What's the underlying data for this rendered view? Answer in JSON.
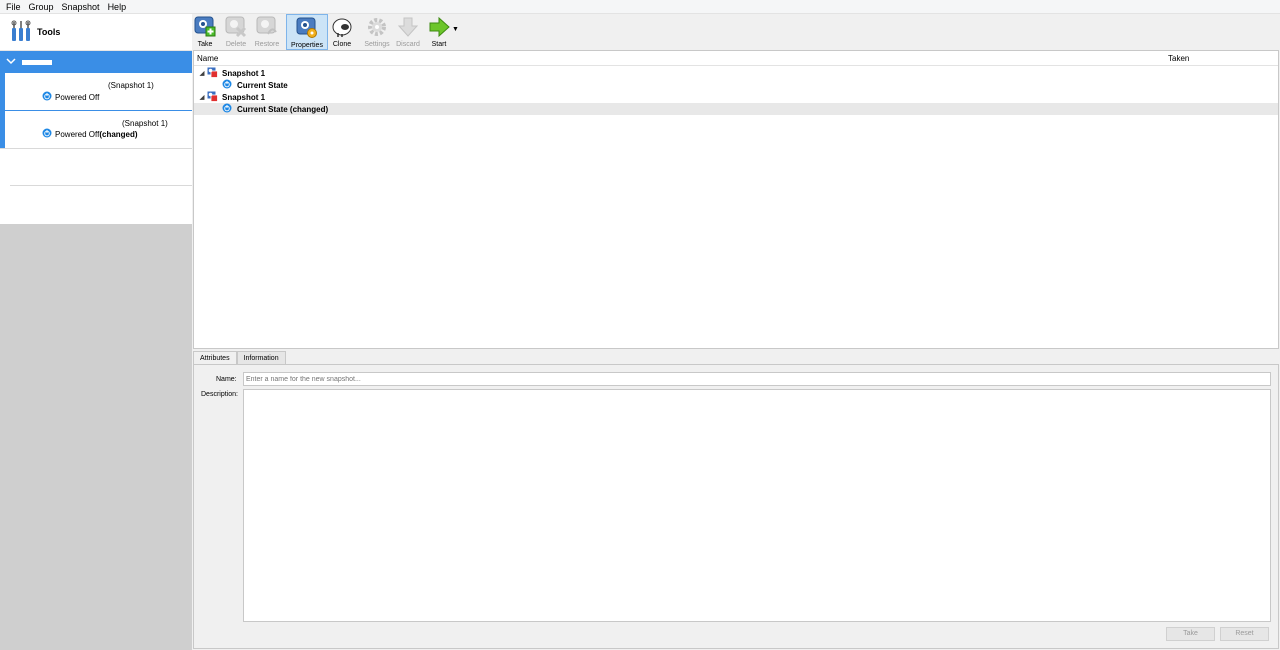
{
  "menu": [
    "File",
    "Group",
    "Snapshot",
    "Help"
  ],
  "sidebar": {
    "tools_label": "Tools",
    "vms": [
      {
        "snapshot": "(Snapshot 1)",
        "state": "Powered Off",
        "changed": ""
      },
      {
        "snapshot": "(Snapshot 1)",
        "state": "Powered Off",
        "changed": "(changed)"
      }
    ]
  },
  "toolbar": {
    "take": "Take",
    "delete": "Delete",
    "restore": "Restore",
    "properties": "Properties",
    "clone": "Clone",
    "settings": "Settings",
    "discard": "Discard",
    "start": "Start"
  },
  "tree": {
    "col_name": "Name",
    "col_taken": "Taken",
    "rows": [
      {
        "label": "Snapshot 1"
      },
      {
        "label": "Current State"
      },
      {
        "label": "Snapshot 1"
      },
      {
        "label": "Current State (changed)"
      }
    ]
  },
  "details": {
    "tab_attributes": "Attributes",
    "tab_information": "Information",
    "name_label": "Name:",
    "name_placeholder": "Enter a name for the new snapshot...",
    "description_label": "Description:",
    "take_button": "Take",
    "reset_button": "Reset"
  },
  "colors": {
    "accent": "#3a8ee6",
    "selection": "#cce4f7"
  }
}
